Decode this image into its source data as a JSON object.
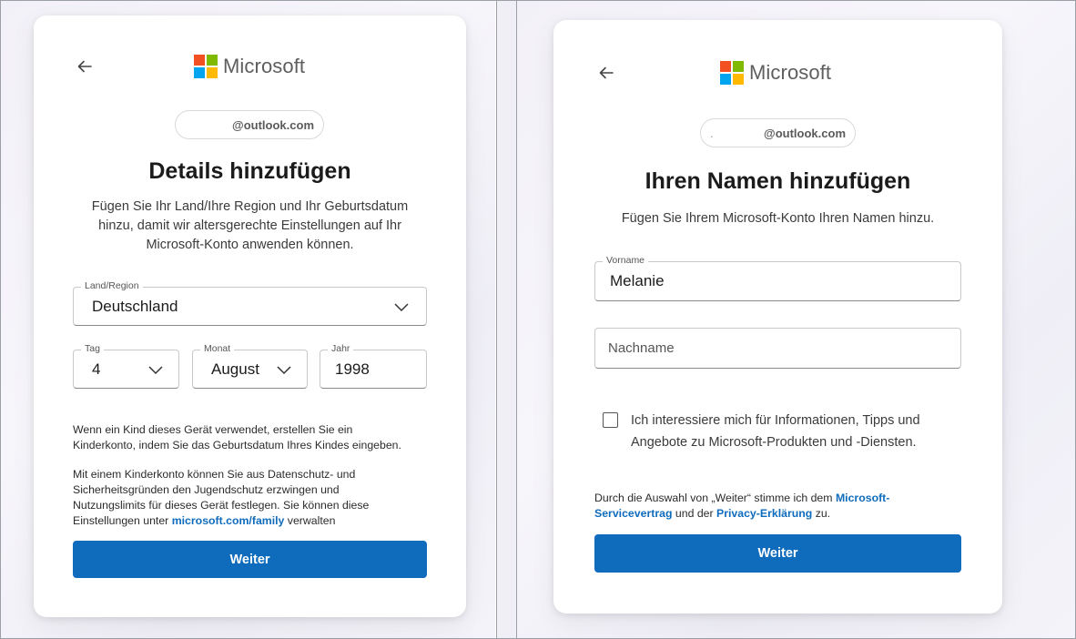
{
  "brand": {
    "name": "Microsoft",
    "logo_colors": [
      "#f25022",
      "#7fba00",
      "#00a4ef",
      "#ffb900"
    ],
    "accent": "#0f6cbd"
  },
  "left_card": {
    "email_suffix": "@outlook.com",
    "title": "Details hinzufügen",
    "subtitle_lines": [
      "Fügen Sie Ihr Land/Ihre Region und Ihr Geburtsdatum",
      "hinzu, damit wir altersgerechte Einstellungen auf Ihr",
      "Microsoft-Konto anwenden können."
    ],
    "country": {
      "label": "Land/Region",
      "value": "Deutschland"
    },
    "day": {
      "label": "Tag",
      "value": "4"
    },
    "month": {
      "label": "Monat",
      "value": "August"
    },
    "year": {
      "label": "Jahr",
      "value": "1998"
    },
    "info1_lines": [
      "Wenn ein Kind dieses Gerät verwendet, erstellen Sie ein",
      "Kinderkonto, indem Sie das Geburtsdatum Ihres Kindes eingeben."
    ],
    "info2_lines": [
      "Mit einem Kinderkonto können Sie aus Datenschutz- und",
      "Sicherheitsgründen den Jugendschutz erzwingen und",
      "Nutzungslimits für dieses Gerät festlegen. Sie können diese"
    ],
    "info2_last_prefix": "Einstellungen unter ",
    "info2_link": "microsoft.com/family",
    "info2_last_suffix": " verwalten",
    "next_button": "Weiter"
  },
  "right_card": {
    "email_prefix": ".",
    "email_suffix": "@outlook.com",
    "title": "Ihren Namen hinzufügen",
    "subtitle": "Fügen Sie Ihrem Microsoft-Konto Ihren Namen hinzu.",
    "first_name": {
      "label": "Vorname",
      "value": "Melanie"
    },
    "last_name": {
      "placeholder": "Nachname"
    },
    "checkbox_lines": [
      "Ich interessiere mich für Informationen, Tipps und",
      "Angebote zu Microsoft-Produkten und -Diensten."
    ],
    "terms_prefix": "Durch die Auswahl von „Weiter“ stimme ich dem ",
    "terms_link1_part1": "Microsoft-",
    "terms_link1_part2": "Servicevertrag",
    "terms_middle": " und der ",
    "terms_link2": "Privacy-Erklärung",
    "terms_suffix": " zu.",
    "next_button": "Weiter"
  }
}
